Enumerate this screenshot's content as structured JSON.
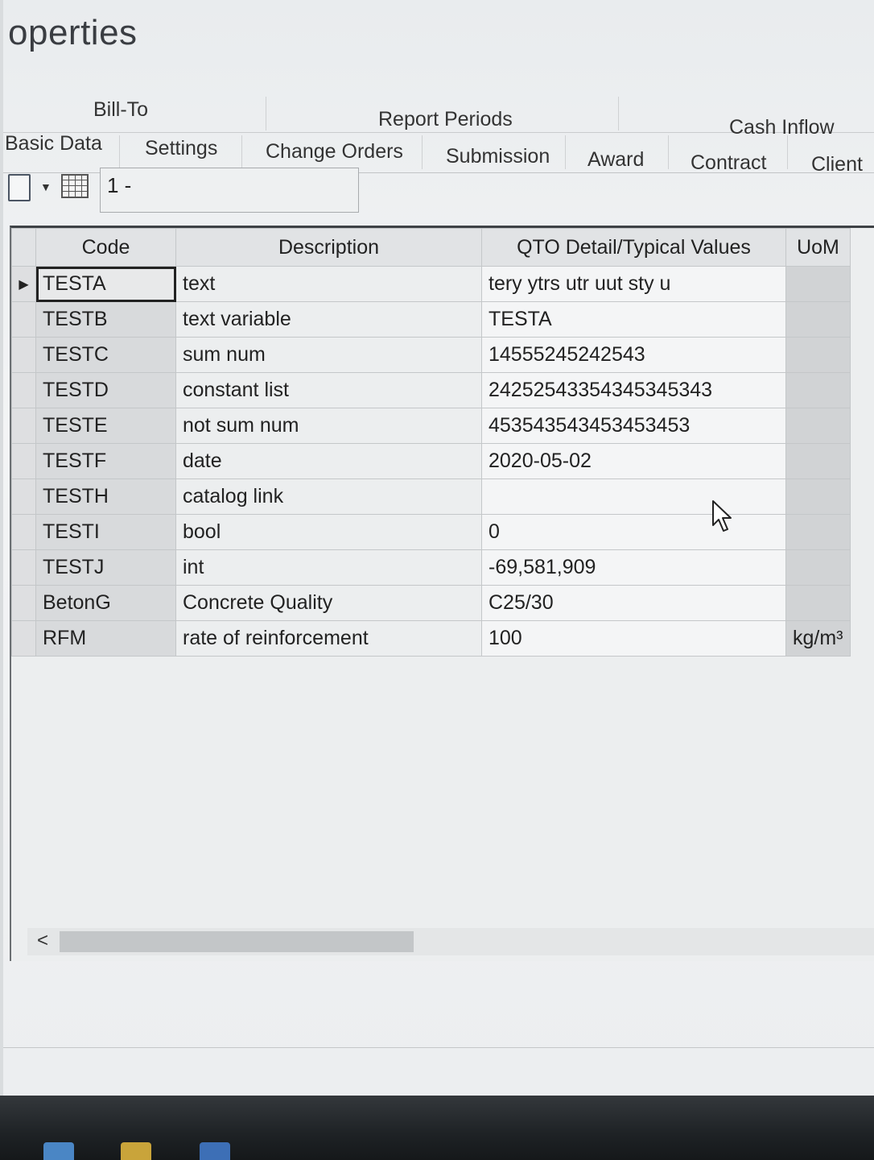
{
  "window": {
    "title": "operties"
  },
  "tabs_row1": [
    "Bill-To",
    "Report Periods",
    "Cash Inflow"
  ],
  "tabs_row2": [
    "Basic Data",
    "Settings",
    "Change Orders",
    "Submission",
    "Award",
    "Contract",
    "Client"
  ],
  "toolbar": {
    "record_value": "1 -"
  },
  "grid": {
    "columns": [
      "Code",
      "Description",
      "QTO Detail/Typical Values",
      "UoM"
    ],
    "rows": [
      {
        "code": "TESTA",
        "description": "text",
        "qto": "tery ytrs utr uut sty  u",
        "uom": ""
      },
      {
        "code": "TESTB",
        "description": "text variable",
        "qto": "TESTA",
        "uom": ""
      },
      {
        "code": "TESTC",
        "description": "sum num",
        "qto": "14555245242543",
        "uom": ""
      },
      {
        "code": "TESTD",
        "description": "constant list",
        "qto": "24252543354345345343",
        "uom": ""
      },
      {
        "code": "TESTE",
        "description": "not sum num",
        "qto": "453543543453453453",
        "uom": ""
      },
      {
        "code": "TESTF",
        "description": "date",
        "qto": "2020-05-02",
        "uom": ""
      },
      {
        "code": "TESTH",
        "description": "catalog link",
        "qto": "",
        "uom": ""
      },
      {
        "code": "TESTI",
        "description": "bool",
        "qto": "0",
        "uom": ""
      },
      {
        "code": "TESTJ",
        "description": "int",
        "qto": "-69,581,909",
        "uom": ""
      },
      {
        "code": "BetonG",
        "description": "Concrete Quality",
        "qto": "C25/30",
        "uom": ""
      },
      {
        "code": "RFM",
        "description": "rate of reinforcement",
        "qto": "100",
        "uom": "kg/m³"
      }
    ],
    "current_row_marker": "▶"
  },
  "scrollbar": {
    "left_arrow": "<"
  },
  "icons": [
    "save-icon",
    "dropdown-arrow-icon",
    "grid-view-icon",
    "mouse-cursor-icon",
    "scroll-left-icon"
  ]
}
